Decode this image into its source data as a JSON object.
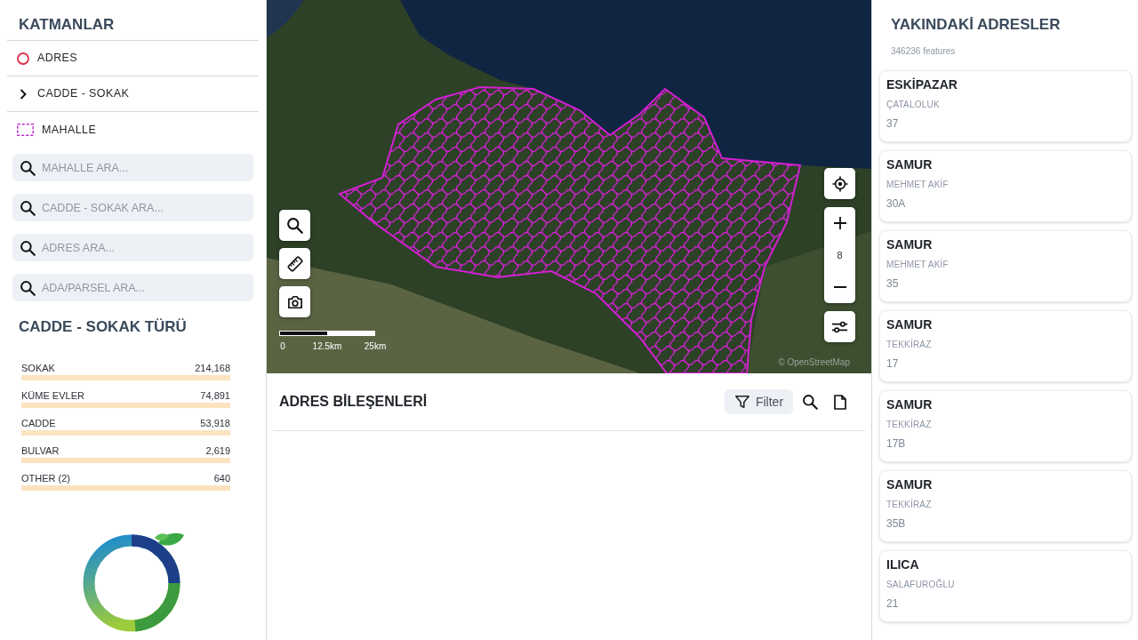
{
  "layers_panel": {
    "title": "KATMANLAR",
    "layers": [
      {
        "label": "ADRES",
        "kind": "point",
        "color": "#e0304a"
      },
      {
        "label": "CADDE - SOKAK",
        "kind": "group",
        "expanded": false
      },
      {
        "label": "MAHALLE",
        "kind": "polygon",
        "color": "#c026d3"
      }
    ],
    "searches": [
      {
        "placeholder": "MAHALLE ARA..."
      },
      {
        "placeholder": "CADDE - SOKAK ARA..."
      },
      {
        "placeholder": "ADRES ARA..."
      },
      {
        "placeholder": "ADA/PARSEL ARA..."
      }
    ]
  },
  "street_types": {
    "title": "CADDE - SOKAK TÜRÜ",
    "items": [
      {
        "label": "SOKAK",
        "value": "214,168"
      },
      {
        "label": "KÜME EVLER",
        "value": "74,891"
      },
      {
        "label": "CADDE",
        "value": "53,918"
      },
      {
        "label": "BULVAR",
        "value": "2,619"
      },
      {
        "label": "OTHER (2)",
        "value": "640"
      }
    ]
  },
  "map": {
    "zoom": "8",
    "scale": [
      "0",
      "12.5km",
      "25km"
    ],
    "attribution": "© OpenStreetMap"
  },
  "components": {
    "title": "ADRES BİLEŞENLERİ",
    "filter_button": "Filter"
  },
  "nearby": {
    "title": "YAKINDAKİ ADRESLER",
    "count": "346236 features",
    "addresses": [
      {
        "name": "ESKİPAZAR",
        "street": "ÇATALOLUK",
        "number": "37"
      },
      {
        "name": "SAMUR",
        "street": "MEHMET AKİF",
        "number": "30A"
      },
      {
        "name": "SAMUR",
        "street": "MEHMET AKİF",
        "number": "35"
      },
      {
        "name": "SAMUR",
        "street": "TEKKİRAZ",
        "number": "17"
      },
      {
        "name": "SAMUR",
        "street": "TEKKİRAZ",
        "number": "17B"
      },
      {
        "name": "SAMUR",
        "street": "TEKKİRAZ",
        "number": "35B"
      },
      {
        "name": "ILICA",
        "street": "SALAFUROĞLU",
        "number": "21"
      }
    ]
  }
}
